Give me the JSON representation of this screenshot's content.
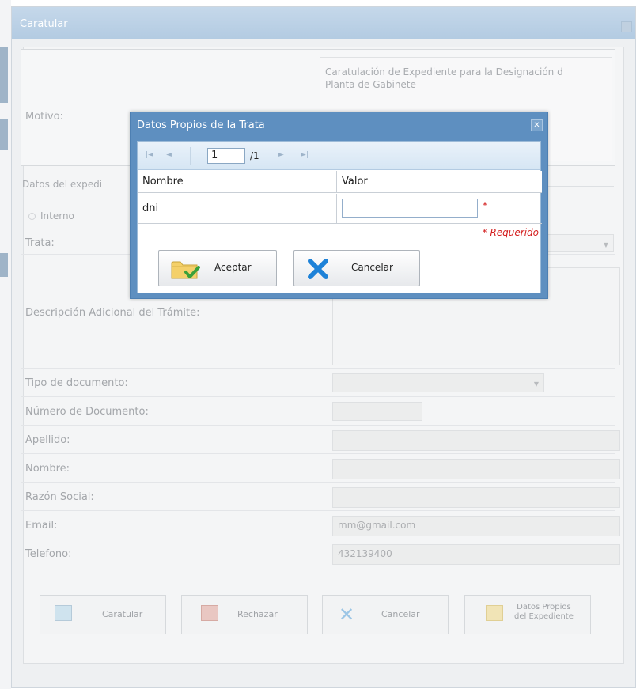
{
  "window": {
    "title": "Caratular"
  },
  "motivo": {
    "label": "Motivo:",
    "text_line1": "Caratulación de Expediente para la Designación d",
    "text_line2": "Planta de Gabinete"
  },
  "section": {
    "label": "Datos del expedi",
    "radio_internal": "Interno"
  },
  "form": {
    "trata_label": "Trata:",
    "descripcion_label": "Descripción Adicional del Trámite:",
    "tipo_doc_label": "Tipo de documento:",
    "numero_doc_label": "Número de Documento:",
    "apellido_label": "Apellido:",
    "nombre_label": "Nombre:",
    "razon_social_label": "Razón Social:",
    "email_label": "Email:",
    "email_value": "mm@gmail.com",
    "telefono_label": "Telefono:",
    "telefono_value": "432139400"
  },
  "buttons": {
    "caratular": "Caratular",
    "rechazar": "Rechazar",
    "cancelar": "Cancelar",
    "datos_propios_line1": "Datos Propios",
    "datos_propios_line2": "del Expediente"
  },
  "modal": {
    "title": "Datos Propios de la Trata",
    "close_glyph": "✕",
    "pager": {
      "first": "|◄",
      "prev": "◄",
      "page": "1",
      "total": "/1",
      "next": "►",
      "last": "►|"
    },
    "grid": {
      "col_nombre": "Nombre",
      "col_valor": "Valor",
      "rows": [
        {
          "nombre": "dni",
          "valor": ""
        }
      ]
    },
    "required_marker": "*",
    "required_note": "* Requerido",
    "aceptar": "Aceptar",
    "cancelar": "Cancelar"
  },
  "colors": {
    "modal_border": "#5e8fc0",
    "required": "#d42020",
    "accept_icon": "#3aa13a",
    "cancel_icon": "#1e82d8"
  }
}
